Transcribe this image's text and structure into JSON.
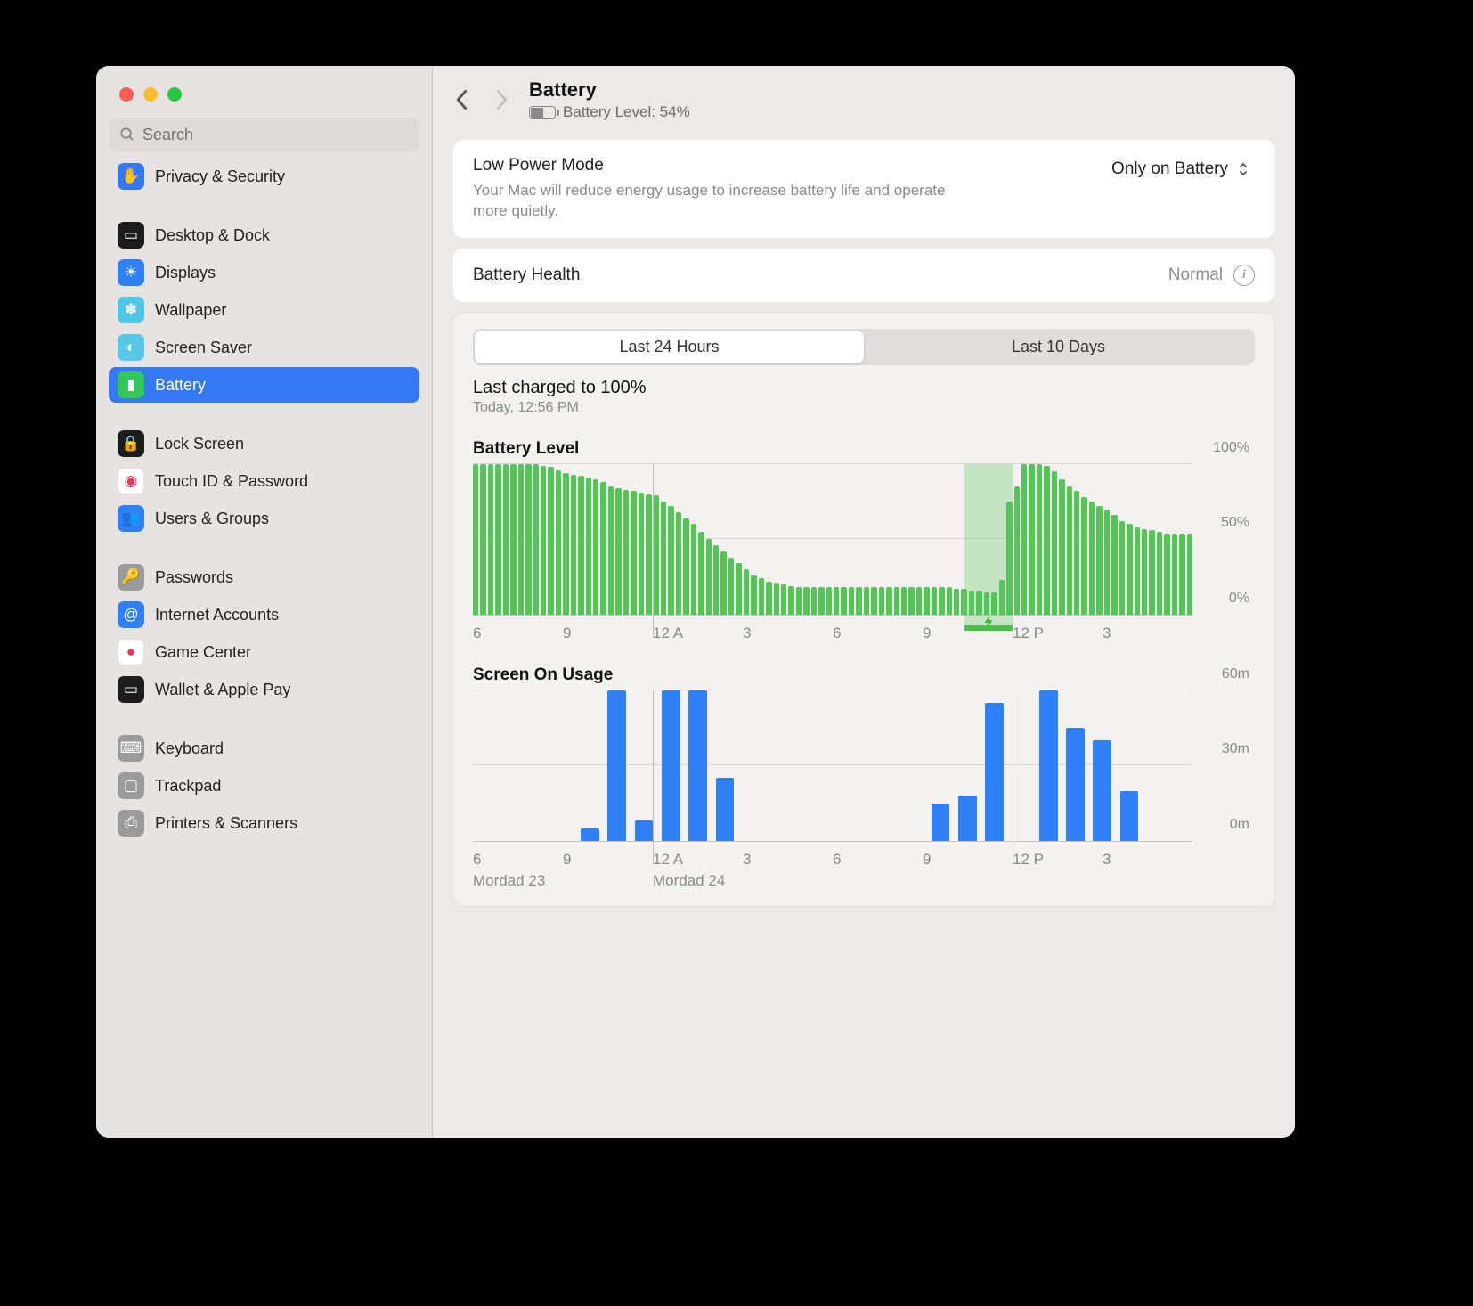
{
  "window": {
    "title": "Battery",
    "subtitle_prefix": "Battery Level:",
    "battery_percent": 54
  },
  "search": {
    "placeholder": "Search"
  },
  "sidebar": {
    "groups": [
      [
        {
          "label": "Privacy & Security",
          "icon": "hand-icon",
          "color": "#3478f6"
        }
      ],
      [
        {
          "label": "Desktop & Dock",
          "icon": "dock-icon",
          "color": "#1c1c1c"
        },
        {
          "label": "Displays",
          "icon": "sun-icon",
          "color": "#2f7ff6"
        },
        {
          "label": "Wallpaper",
          "icon": "flower-icon",
          "color": "#4ec7e6"
        },
        {
          "label": "Screen Saver",
          "icon": "screensaver-icon",
          "color": "#57c8e8"
        },
        {
          "label": "Battery",
          "icon": "battery-icon",
          "color": "#32c759",
          "selected": true
        }
      ],
      [
        {
          "label": "Lock Screen",
          "icon": "lock-icon",
          "color": "#1c1c1c"
        },
        {
          "label": "Touch ID & Password",
          "icon": "fingerprint-icon",
          "color": "#ffffff"
        },
        {
          "label": "Users & Groups",
          "icon": "users-icon",
          "color": "#2f7ff6"
        }
      ],
      [
        {
          "label": "Passwords",
          "icon": "key-icon",
          "color": "#9b9b9b"
        },
        {
          "label": "Internet Accounts",
          "icon": "at-icon",
          "color": "#2f7ff6"
        },
        {
          "label": "Game Center",
          "icon": "gamecenter-icon",
          "color": "#ffffff"
        },
        {
          "label": "Wallet & Apple Pay",
          "icon": "wallet-icon",
          "color": "#1c1c1c"
        }
      ],
      [
        {
          "label": "Keyboard",
          "icon": "keyboard-icon",
          "color": "#9b9b9b"
        },
        {
          "label": "Trackpad",
          "icon": "trackpad-icon",
          "color": "#9b9b9b"
        },
        {
          "label": "Printers & Scanners",
          "icon": "printer-icon",
          "color": "#9b9b9b"
        }
      ]
    ]
  },
  "low_power": {
    "title": "Low Power Mode",
    "desc": "Your Mac will reduce energy usage to increase battery life and operate more quietly.",
    "value": "Only on Battery"
  },
  "battery_health": {
    "title": "Battery Health",
    "value": "Normal"
  },
  "tabs": {
    "a": "Last 24 Hours",
    "b": "Last 10 Days",
    "active": "a"
  },
  "last_charged": {
    "title": "Last charged to 100%",
    "sub": "Today, 12:56 PM"
  },
  "chart_data": [
    {
      "type": "bar",
      "title": "Battery Level",
      "xticks": [
        "6",
        "9",
        "12 A",
        "3",
        "6",
        "9",
        "12 P",
        "3"
      ],
      "yticks": [
        "0%",
        "50%",
        "100%"
      ],
      "ylim": [
        0,
        100
      ],
      "x_count_per_tick": 12,
      "charging_band": {
        "start_frac": 0.683,
        "end_frac": 0.75
      },
      "values": [
        100,
        100,
        100,
        100,
        100,
        100,
        100,
        100,
        100,
        99,
        98,
        96,
        94,
        93,
        92,
        91,
        90,
        88,
        85,
        84,
        83,
        82,
        81,
        80,
        79,
        75,
        72,
        68,
        64,
        60,
        55,
        50,
        46,
        42,
        38,
        34,
        30,
        26,
        24,
        22,
        21,
        20,
        19,
        18,
        18,
        18,
        18,
        18,
        18,
        18,
        18,
        18,
        18,
        18,
        18,
        18,
        18,
        18,
        18,
        18,
        18,
        18,
        18,
        18,
        17,
        17,
        16,
        16,
        15,
        15,
        23,
        75,
        85,
        100,
        100,
        100,
        99,
        95,
        90,
        85,
        82,
        78,
        75,
        72,
        70,
        66,
        62,
        60,
        58,
        57,
        56,
        55,
        54,
        54,
        54,
        54
      ]
    },
    {
      "type": "bar",
      "title": "Screen On Usage",
      "xticks": [
        "6",
        "9",
        "12 A",
        "3",
        "6",
        "9",
        "12 P",
        "3"
      ],
      "yticks": [
        "0m",
        "30m",
        "60m"
      ],
      "ylim": [
        0,
        60
      ],
      "date_labels": [
        "Mordad 23",
        "",
        "Mordad 24",
        "",
        "",
        "",
        "",
        ""
      ],
      "values": [
        0,
        0,
        0,
        0,
        5,
        60,
        8,
        60,
        60,
        25,
        0,
        0,
        0,
        0,
        0,
        0,
        0,
        15,
        18,
        55,
        0,
        60,
        45,
        40,
        20,
        0,
        0
      ]
    }
  ]
}
